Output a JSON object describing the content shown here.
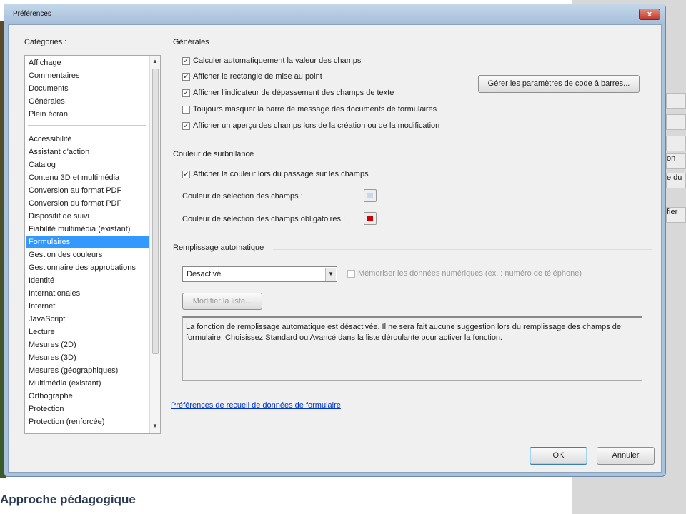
{
  "background": {
    "right_fragments": [
      "on",
      "e du",
      "fier"
    ],
    "page_heading": "Approche pédagogique"
  },
  "dialog": {
    "title": "Préférences",
    "close_label": "x"
  },
  "categories": {
    "label": "Catégories :",
    "group1": [
      "Affichage",
      "Commentaires",
      "Documents",
      "Générales",
      "Plein écran"
    ],
    "group2": [
      "Accessibilité",
      "Assistant d'action",
      "Catalog",
      "Contenu 3D et multimédia",
      "Conversion au format PDF",
      "Conversion du format PDF",
      "Dispositif de suivi",
      "Fiabilité multimédia (existant)",
      "Formulaires",
      "Gestion des couleurs",
      "Gestionnaire des approbations",
      "Identité",
      "Internationales",
      "Internet",
      "JavaScript",
      "Lecture",
      "Mesures (2D)",
      "Mesures (3D)",
      "Mesures (géographiques)",
      "Multimédia (existant)",
      "Orthographe",
      "Protection",
      "Protection (renforcée)"
    ],
    "selected": "Formulaires"
  },
  "general": {
    "heading": "Générales",
    "options": [
      {
        "label": "Calculer automatiquement la valeur des champs",
        "checked": true
      },
      {
        "label": "Afficher le rectangle de mise au point",
        "checked": true
      },
      {
        "label": "Afficher l'indicateur de dépassement des champs de texte",
        "checked": true
      },
      {
        "label": "Toujours masquer la barre de message des documents de formulaires",
        "checked": false
      },
      {
        "label": "Afficher un aperçu des champs lors de la création ou de la modification",
        "checked": true
      }
    ],
    "barcode_button": "Gérer les paramètres de code à barres..."
  },
  "highlight": {
    "heading": "Couleur de surbrillance",
    "show_on_hover": {
      "label": "Afficher la couleur lors du passage sur les champs",
      "checked": true
    },
    "field_color_label": "Couleur de sélection des champs :",
    "field_color": "#c8d8f0",
    "required_color_label": "Couleur de sélection des champs obligatoires :",
    "required_color": "#cc0000"
  },
  "autofill": {
    "heading": "Remplissage automatique",
    "select_value": "Désactivé",
    "remember_numbers": {
      "label": "Mémoriser les données numériques (ex. : numéro de téléphone)",
      "checked": false
    },
    "edit_list_button": "Modifier la liste...",
    "description": "La fonction de remplissage automatique est désactivée. Il ne sera fait aucune suggestion lors du remplissage des champs de formulaire. Choisissez Standard ou Avancé dans la liste déroulante pour activer la fonction."
  },
  "link": "Préférences de recueil de données de formulaire",
  "buttons": {
    "ok": "OK",
    "cancel": "Annuler"
  }
}
